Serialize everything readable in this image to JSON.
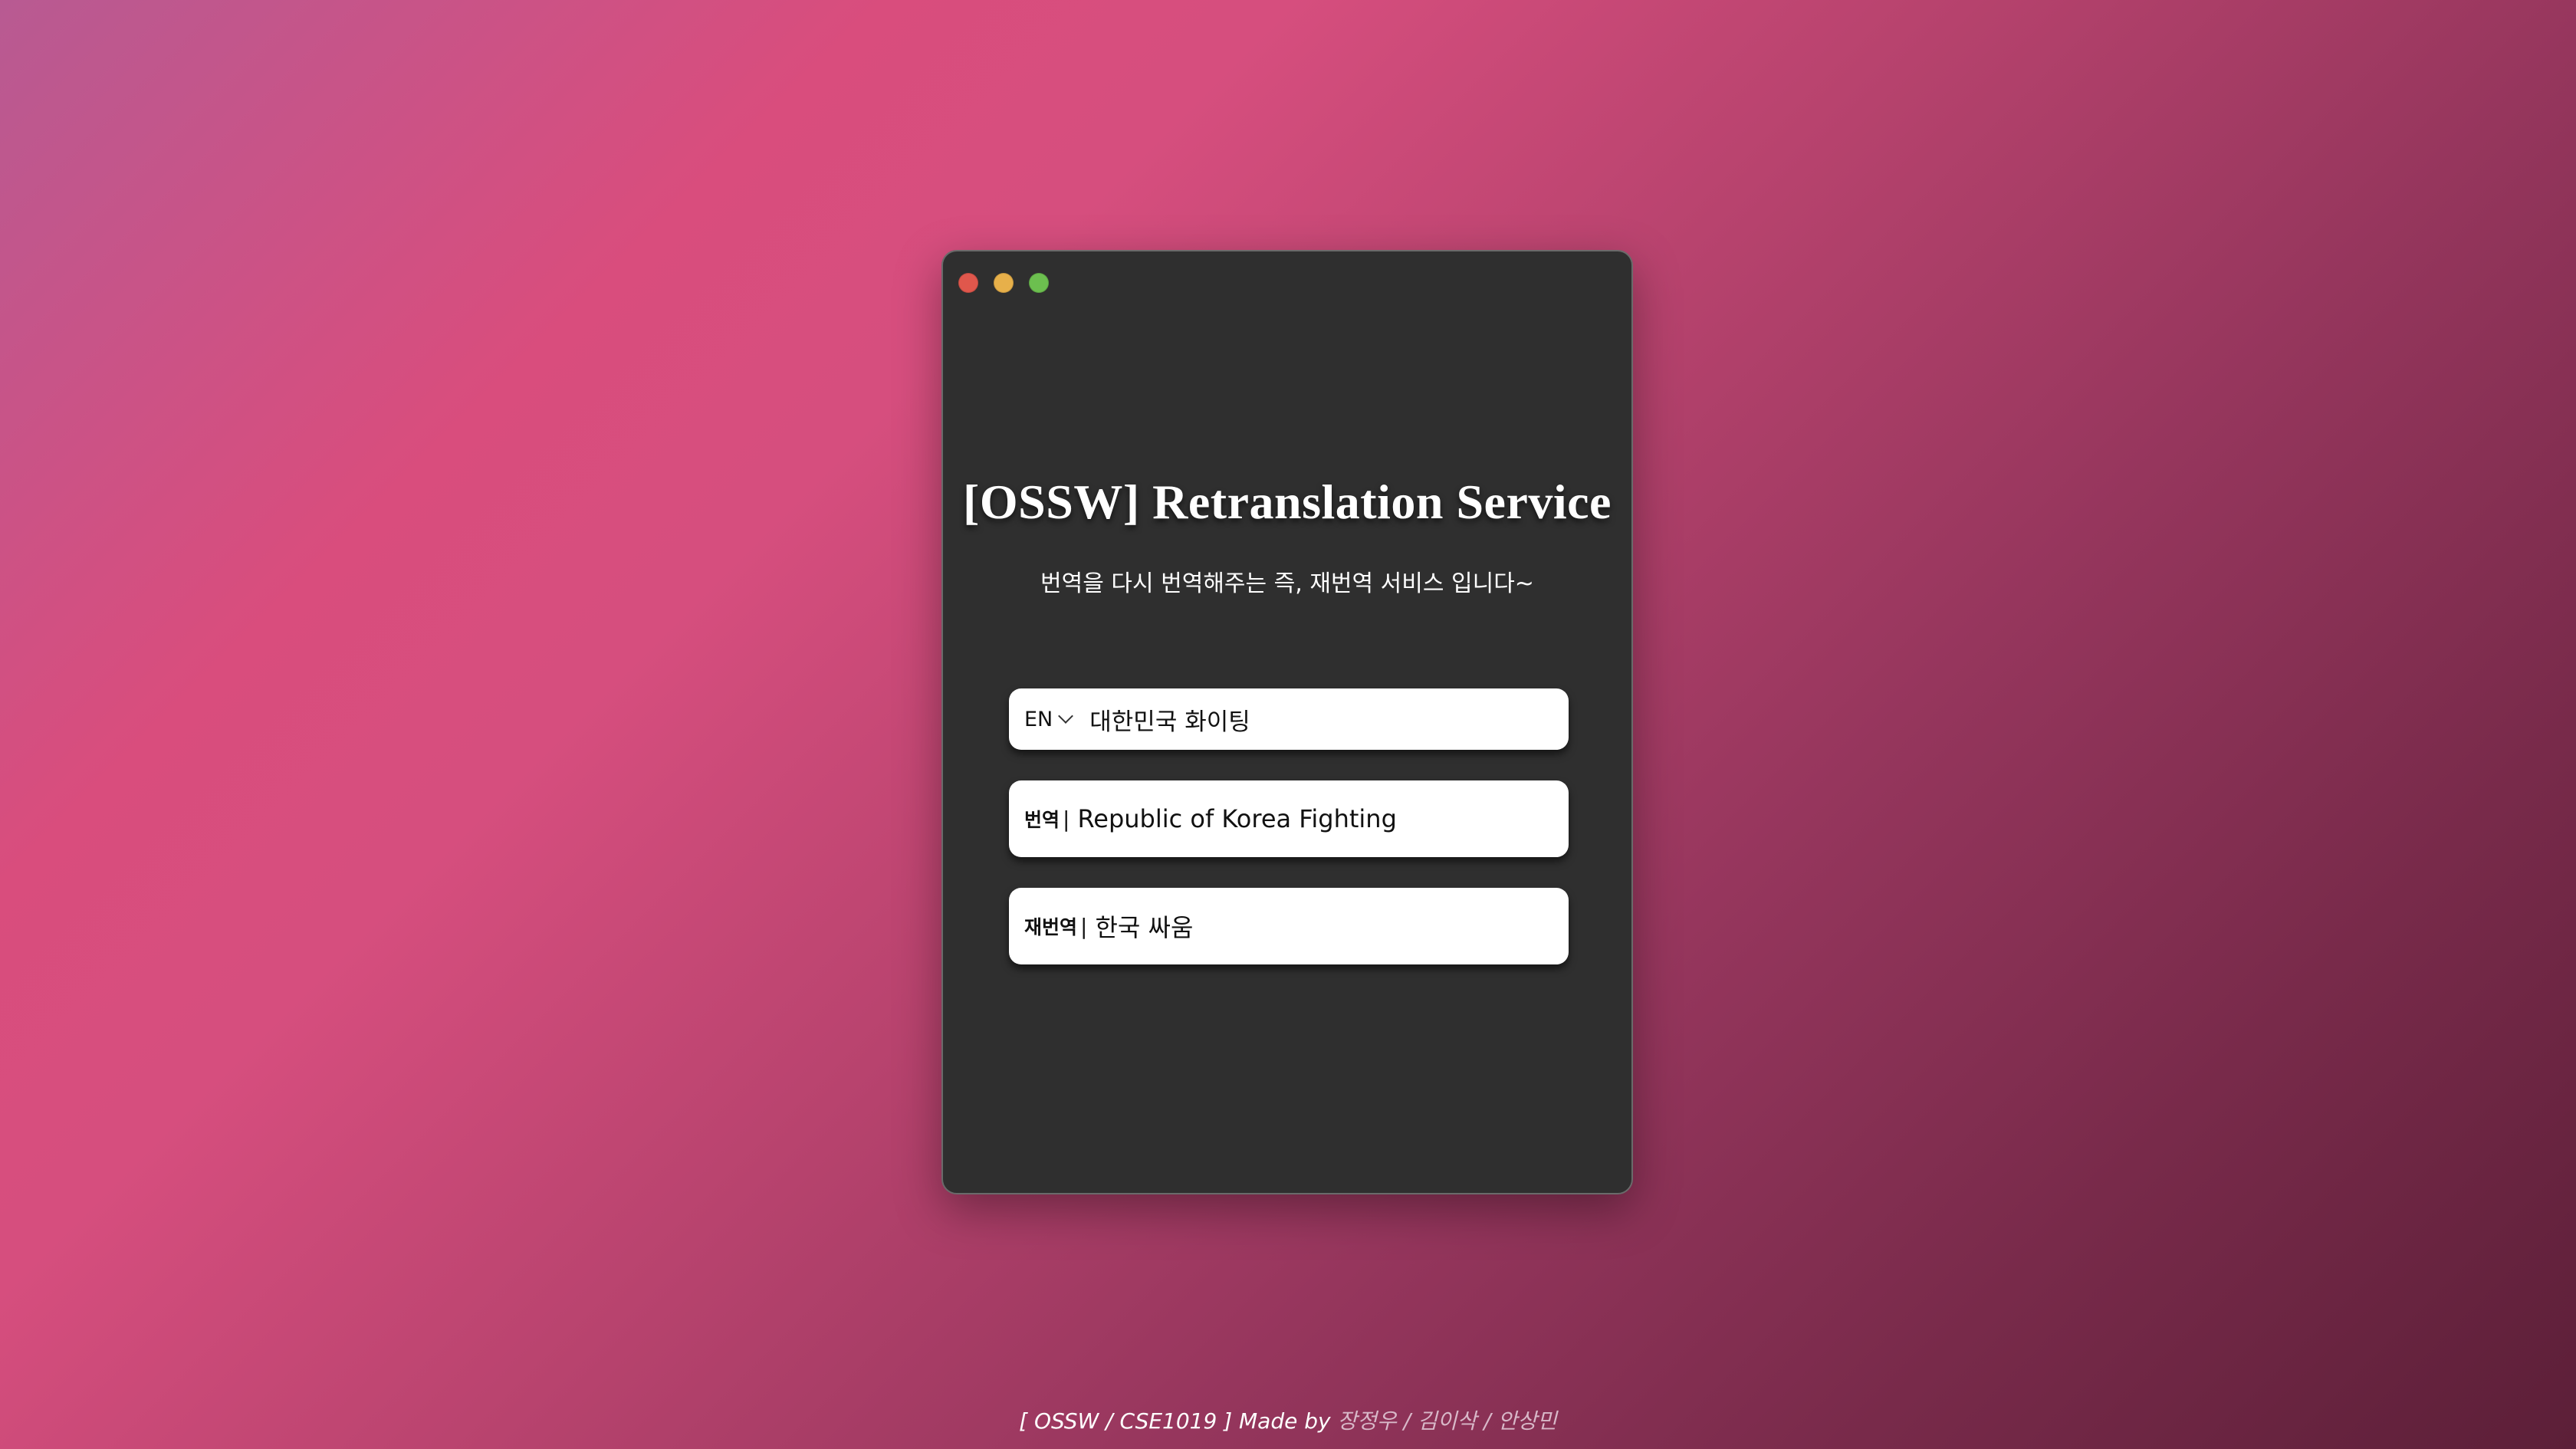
{
  "window": {
    "title": "[OSSW] Retranslation Service",
    "subtitle": "번역을 다시 번역해주는 즉, 재번역 서비스 입니다~"
  },
  "input": {
    "language": "EN",
    "value": "대한민국 화이팅"
  },
  "translation": {
    "label": "번역",
    "separator": "|",
    "value": "Republic of Korea Fighting"
  },
  "retranslation": {
    "label": "재번역",
    "separator": "|",
    "value": "한국 싸움"
  },
  "footer": {
    "prefix": "[ OSSW / CSE1019 ] Made by",
    "authors": "장정우 / 김이삭 / 안상민"
  },
  "colors": {
    "window_bg": "#2f2f2f",
    "close": "#e0574c",
    "minimize": "#e7b04a",
    "maximize": "#6cbf4f"
  }
}
